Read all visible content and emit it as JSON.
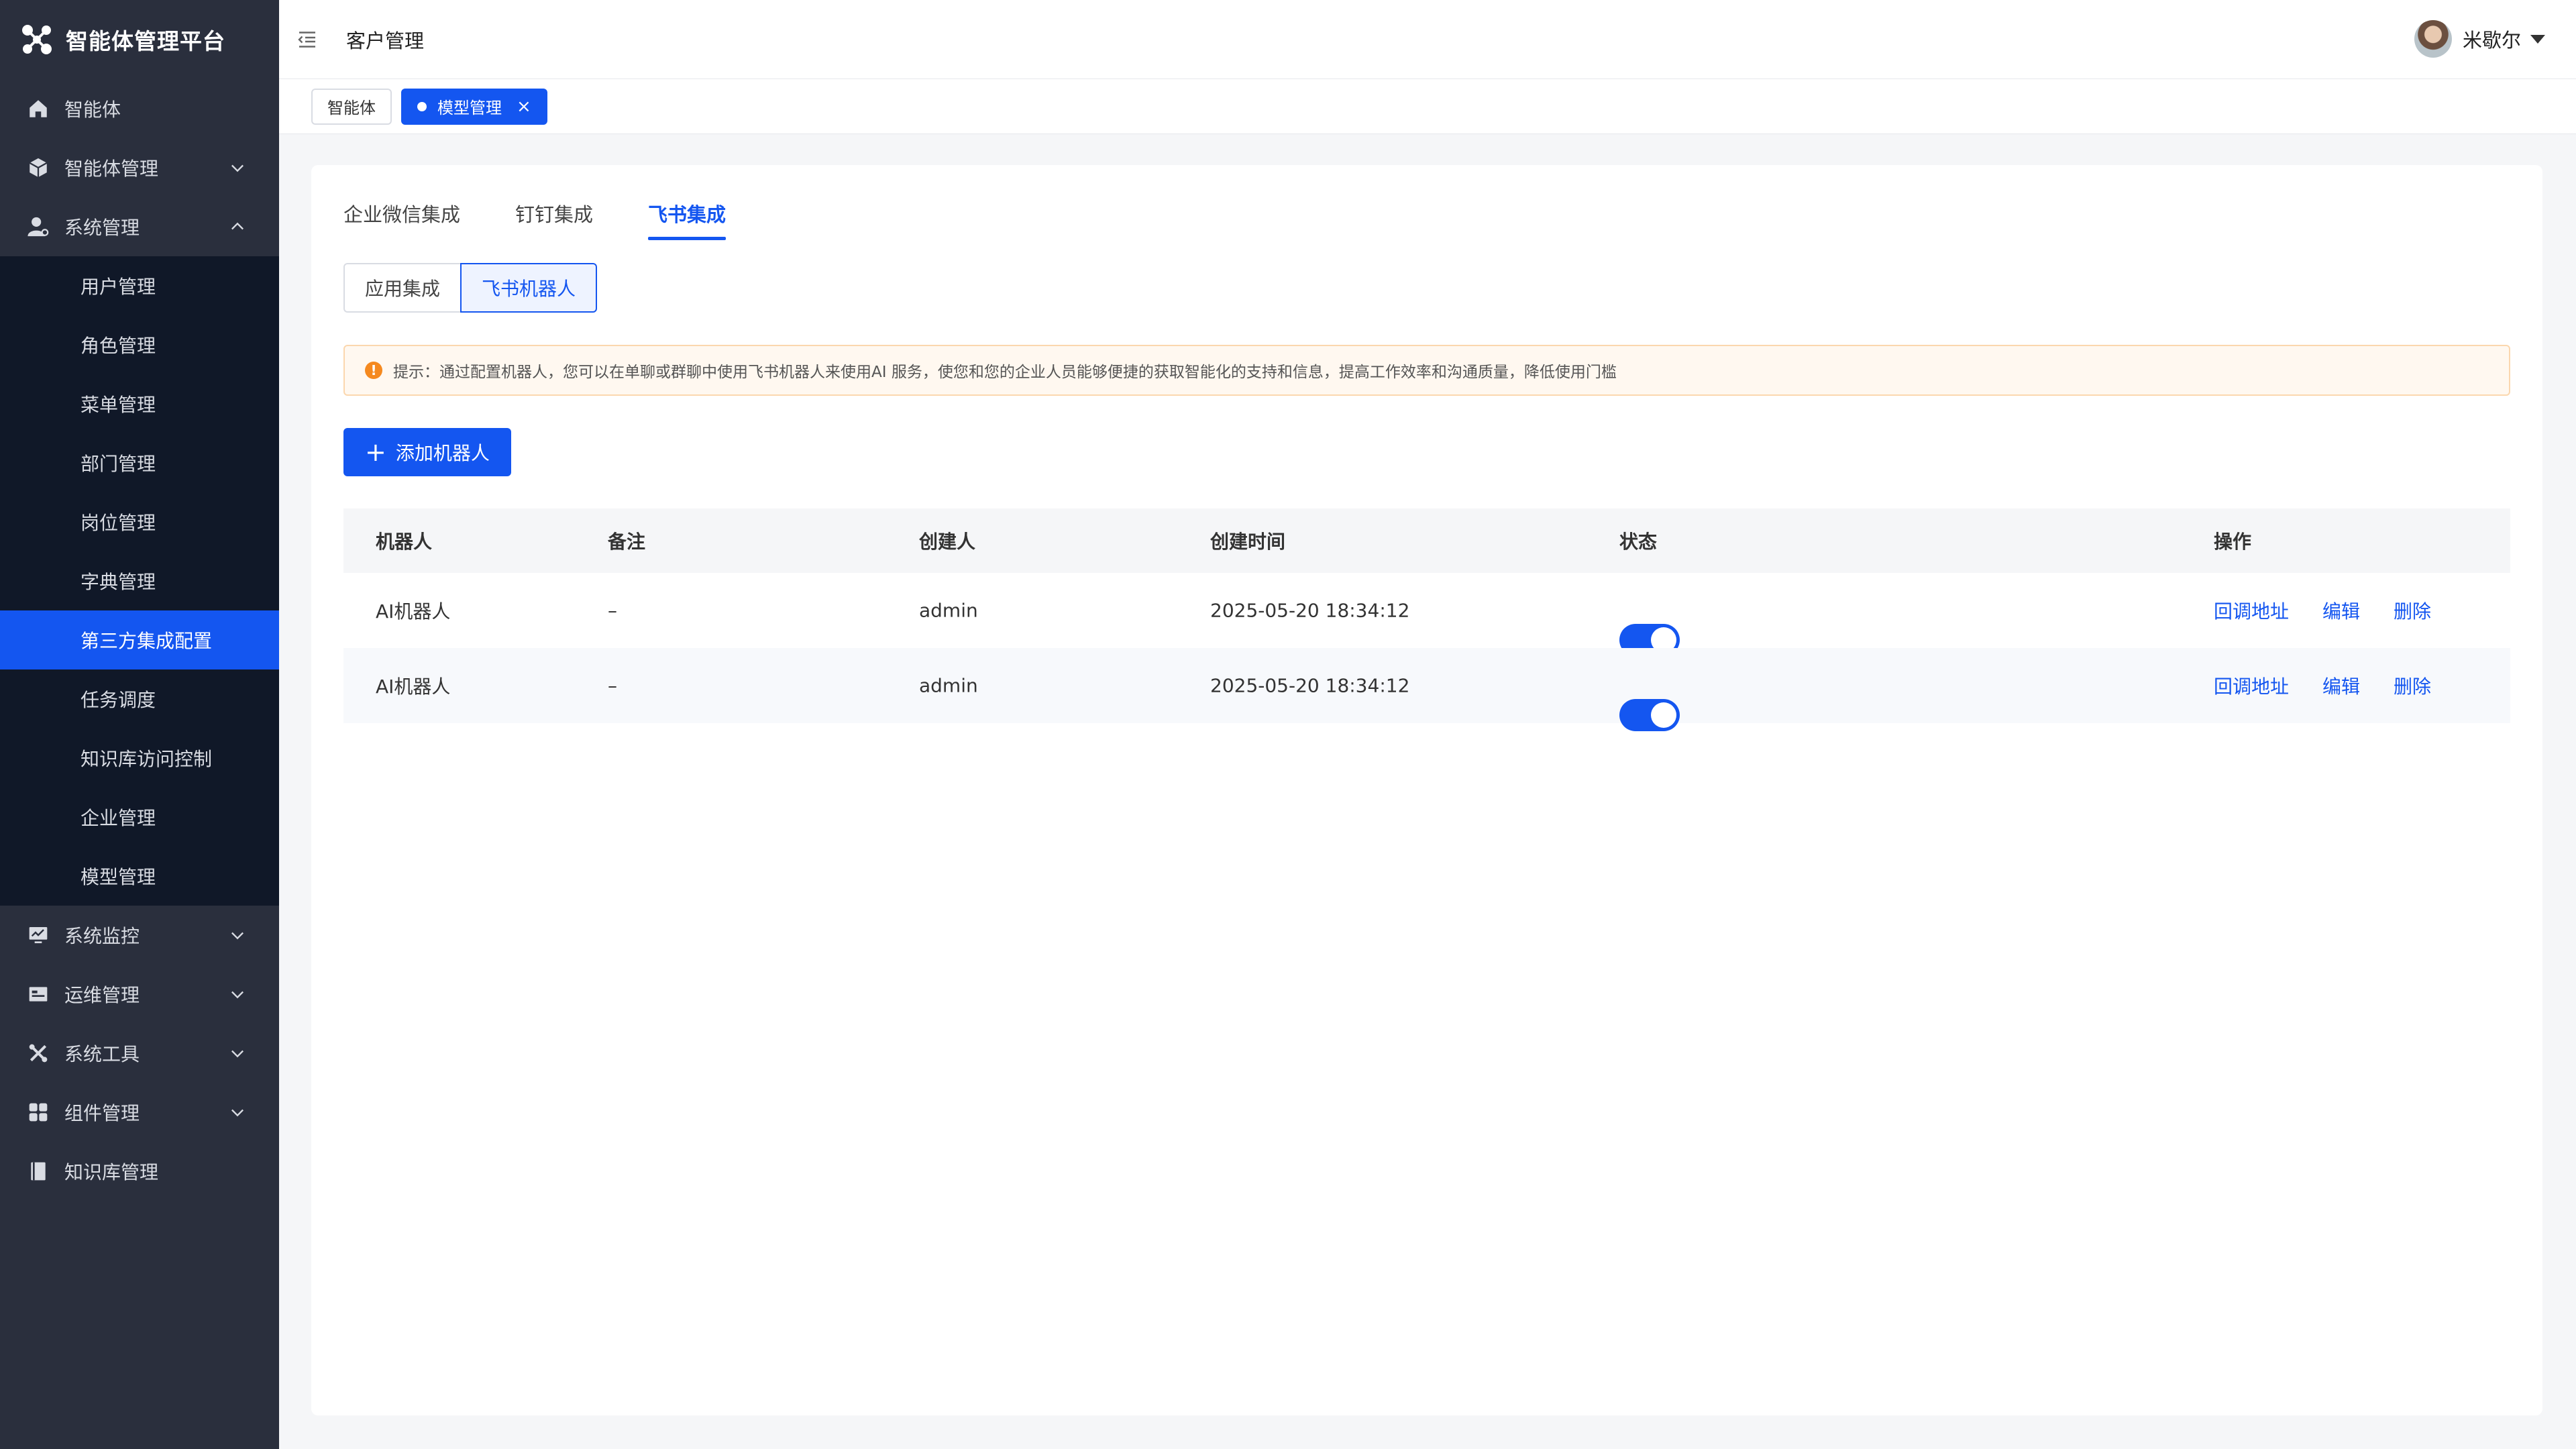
{
  "brand": {
    "title": "智能体管理平台"
  },
  "sidebar": {
    "items": [
      {
        "label": "智能体",
        "icon": "home-icon"
      },
      {
        "label": "智能体管理",
        "icon": "cube-icon",
        "expandable": true
      },
      {
        "label": "系统管理",
        "icon": "user-gear-icon",
        "expanded": true
      }
    ],
    "submenu": [
      {
        "label": "用户管理"
      },
      {
        "label": "角色管理"
      },
      {
        "label": "菜单管理"
      },
      {
        "label": "部门管理"
      },
      {
        "label": "岗位管理"
      },
      {
        "label": "字典管理"
      },
      {
        "label": "第三方集成配置",
        "active": true
      },
      {
        "label": "任务调度"
      },
      {
        "label": "知识库访问控制"
      },
      {
        "label": "企业管理"
      },
      {
        "label": "模型管理"
      }
    ],
    "items_after": [
      {
        "label": "系统监控",
        "icon": "monitor-icon"
      },
      {
        "label": "运维管理",
        "icon": "ops-icon"
      },
      {
        "label": "系统工具",
        "icon": "tools-icon"
      },
      {
        "label": "组件管理",
        "icon": "grid-icon"
      },
      {
        "label": "知识库管理",
        "icon": "book-icon"
      }
    ]
  },
  "header": {
    "title": "客户管理",
    "user_name": "米歇尔"
  },
  "tagbar": {
    "tags": [
      {
        "label": "智能体"
      },
      {
        "label": "模型管理"
      }
    ],
    "close_glyph": "×"
  },
  "tabs": [
    "企业微信集成",
    "钉钉集成",
    "飞书集成"
  ],
  "segments": [
    "应用集成",
    "飞书机器人"
  ],
  "alert": {
    "icon_glyph": "!",
    "text": "提示：通过配置机器人，您可以在单聊或群聊中使用飞书机器人来使用AI 服务，使您和您的企业人员能够便捷的获取智能化的支持和信息，提高工作效率和沟通质量，降低使用门槛"
  },
  "add_button": {
    "plus": "+",
    "label": "添加机器人"
  },
  "table": {
    "headers": [
      "机器人",
      "备注",
      "创建人",
      "创建时间",
      "状态",
      "操作"
    ],
    "rows": [
      {
        "robot": "AI机器人",
        "note": "–",
        "creator": "admin",
        "created": "2025-05-20   18:34:12",
        "status_on": true
      },
      {
        "robot": "AI机器人",
        "note": "–",
        "creator": "admin",
        "created": "2025-05-20   18:34:12",
        "status_on": true
      }
    ],
    "actions": [
      "回调地址",
      "编辑",
      "删除"
    ]
  },
  "colors": {
    "sidebar": "#2a2f3d",
    "submenu": "#101828",
    "accent": "#1456f0",
    "alert_bg": "#fff8f0",
    "alert_icon": "#f5891f"
  }
}
